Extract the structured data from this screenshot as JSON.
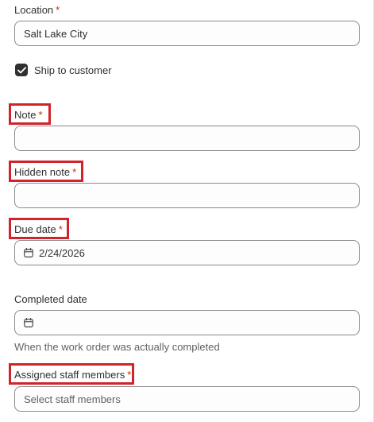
{
  "location": {
    "label": "Location",
    "required_mark": "*",
    "value": "Salt Lake City"
  },
  "ship_to_customer": {
    "label": "Ship to customer",
    "checked": true
  },
  "note": {
    "label": "Note",
    "required_mark": "*",
    "value": ""
  },
  "hidden_note": {
    "label": "Hidden note",
    "required_mark": "*",
    "value": ""
  },
  "due_date": {
    "label": "Due date",
    "required_mark": "*",
    "value": "2/24/2026",
    "icon": "calendar-icon"
  },
  "completed_date": {
    "label": "Completed date",
    "value": "",
    "icon": "calendar-icon",
    "help_text": "When the work order was actually completed"
  },
  "assigned_staff": {
    "label": "Assigned staff members",
    "required_mark": "*",
    "placeholder": "Select staff members"
  },
  "colors": {
    "required": "#c5280c",
    "highlight": "#d0232a",
    "checkbox": "#303030"
  }
}
